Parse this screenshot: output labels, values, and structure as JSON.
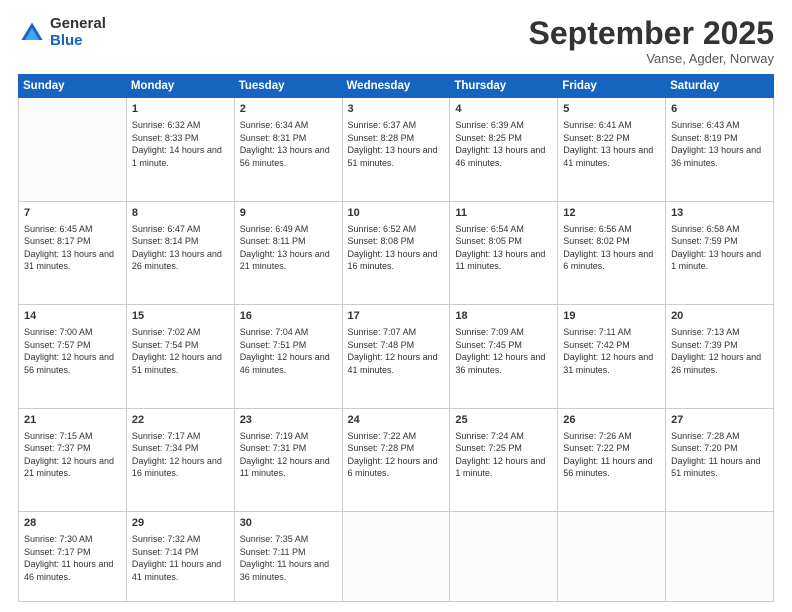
{
  "logo": {
    "general": "General",
    "blue": "Blue"
  },
  "header": {
    "month": "September 2025",
    "location": "Vanse, Agder, Norway"
  },
  "weekdays": [
    "Sunday",
    "Monday",
    "Tuesday",
    "Wednesday",
    "Thursday",
    "Friday",
    "Saturday"
  ],
  "weeks": [
    [
      {
        "day": "",
        "sunrise": "",
        "sunset": "",
        "daylight": ""
      },
      {
        "day": "1",
        "sunrise": "Sunrise: 6:32 AM",
        "sunset": "Sunset: 8:33 PM",
        "daylight": "Daylight: 14 hours and 1 minute."
      },
      {
        "day": "2",
        "sunrise": "Sunrise: 6:34 AM",
        "sunset": "Sunset: 8:31 PM",
        "daylight": "Daylight: 13 hours and 56 minutes."
      },
      {
        "day": "3",
        "sunrise": "Sunrise: 6:37 AM",
        "sunset": "Sunset: 8:28 PM",
        "daylight": "Daylight: 13 hours and 51 minutes."
      },
      {
        "day": "4",
        "sunrise": "Sunrise: 6:39 AM",
        "sunset": "Sunset: 8:25 PM",
        "daylight": "Daylight: 13 hours and 46 minutes."
      },
      {
        "day": "5",
        "sunrise": "Sunrise: 6:41 AM",
        "sunset": "Sunset: 8:22 PM",
        "daylight": "Daylight: 13 hours and 41 minutes."
      },
      {
        "day": "6",
        "sunrise": "Sunrise: 6:43 AM",
        "sunset": "Sunset: 8:19 PM",
        "daylight": "Daylight: 13 hours and 36 minutes."
      }
    ],
    [
      {
        "day": "7",
        "sunrise": "Sunrise: 6:45 AM",
        "sunset": "Sunset: 8:17 PM",
        "daylight": "Daylight: 13 hours and 31 minutes."
      },
      {
        "day": "8",
        "sunrise": "Sunrise: 6:47 AM",
        "sunset": "Sunset: 8:14 PM",
        "daylight": "Daylight: 13 hours and 26 minutes."
      },
      {
        "day": "9",
        "sunrise": "Sunrise: 6:49 AM",
        "sunset": "Sunset: 8:11 PM",
        "daylight": "Daylight: 13 hours and 21 minutes."
      },
      {
        "day": "10",
        "sunrise": "Sunrise: 6:52 AM",
        "sunset": "Sunset: 8:08 PM",
        "daylight": "Daylight: 13 hours and 16 minutes."
      },
      {
        "day": "11",
        "sunrise": "Sunrise: 6:54 AM",
        "sunset": "Sunset: 8:05 PM",
        "daylight": "Daylight: 13 hours and 11 minutes."
      },
      {
        "day": "12",
        "sunrise": "Sunrise: 6:56 AM",
        "sunset": "Sunset: 8:02 PM",
        "daylight": "Daylight: 13 hours and 6 minutes."
      },
      {
        "day": "13",
        "sunrise": "Sunrise: 6:58 AM",
        "sunset": "Sunset: 7:59 PM",
        "daylight": "Daylight: 13 hours and 1 minute."
      }
    ],
    [
      {
        "day": "14",
        "sunrise": "Sunrise: 7:00 AM",
        "sunset": "Sunset: 7:57 PM",
        "daylight": "Daylight: 12 hours and 56 minutes."
      },
      {
        "day": "15",
        "sunrise": "Sunrise: 7:02 AM",
        "sunset": "Sunset: 7:54 PM",
        "daylight": "Daylight: 12 hours and 51 minutes."
      },
      {
        "day": "16",
        "sunrise": "Sunrise: 7:04 AM",
        "sunset": "Sunset: 7:51 PM",
        "daylight": "Daylight: 12 hours and 46 minutes."
      },
      {
        "day": "17",
        "sunrise": "Sunrise: 7:07 AM",
        "sunset": "Sunset: 7:48 PM",
        "daylight": "Daylight: 12 hours and 41 minutes."
      },
      {
        "day": "18",
        "sunrise": "Sunrise: 7:09 AM",
        "sunset": "Sunset: 7:45 PM",
        "daylight": "Daylight: 12 hours and 36 minutes."
      },
      {
        "day": "19",
        "sunrise": "Sunrise: 7:11 AM",
        "sunset": "Sunset: 7:42 PM",
        "daylight": "Daylight: 12 hours and 31 minutes."
      },
      {
        "day": "20",
        "sunrise": "Sunrise: 7:13 AM",
        "sunset": "Sunset: 7:39 PM",
        "daylight": "Daylight: 12 hours and 26 minutes."
      }
    ],
    [
      {
        "day": "21",
        "sunrise": "Sunrise: 7:15 AM",
        "sunset": "Sunset: 7:37 PM",
        "daylight": "Daylight: 12 hours and 21 minutes."
      },
      {
        "day": "22",
        "sunrise": "Sunrise: 7:17 AM",
        "sunset": "Sunset: 7:34 PM",
        "daylight": "Daylight: 12 hours and 16 minutes."
      },
      {
        "day": "23",
        "sunrise": "Sunrise: 7:19 AM",
        "sunset": "Sunset: 7:31 PM",
        "daylight": "Daylight: 12 hours and 11 minutes."
      },
      {
        "day": "24",
        "sunrise": "Sunrise: 7:22 AM",
        "sunset": "Sunset: 7:28 PM",
        "daylight": "Daylight: 12 hours and 6 minutes."
      },
      {
        "day": "25",
        "sunrise": "Sunrise: 7:24 AM",
        "sunset": "Sunset: 7:25 PM",
        "daylight": "Daylight: 12 hours and 1 minute."
      },
      {
        "day": "26",
        "sunrise": "Sunrise: 7:26 AM",
        "sunset": "Sunset: 7:22 PM",
        "daylight": "Daylight: 11 hours and 56 minutes."
      },
      {
        "day": "27",
        "sunrise": "Sunrise: 7:28 AM",
        "sunset": "Sunset: 7:20 PM",
        "daylight": "Daylight: 11 hours and 51 minutes."
      }
    ],
    [
      {
        "day": "28",
        "sunrise": "Sunrise: 7:30 AM",
        "sunset": "Sunset: 7:17 PM",
        "daylight": "Daylight: 11 hours and 46 minutes."
      },
      {
        "day": "29",
        "sunrise": "Sunrise: 7:32 AM",
        "sunset": "Sunset: 7:14 PM",
        "daylight": "Daylight: 11 hours and 41 minutes."
      },
      {
        "day": "30",
        "sunrise": "Sunrise: 7:35 AM",
        "sunset": "Sunset: 7:11 PM",
        "daylight": "Daylight: 11 hours and 36 minutes."
      },
      {
        "day": "",
        "sunrise": "",
        "sunset": "",
        "daylight": ""
      },
      {
        "day": "",
        "sunrise": "",
        "sunset": "",
        "daylight": ""
      },
      {
        "day": "",
        "sunrise": "",
        "sunset": "",
        "daylight": ""
      },
      {
        "day": "",
        "sunrise": "",
        "sunset": "",
        "daylight": ""
      }
    ]
  ]
}
